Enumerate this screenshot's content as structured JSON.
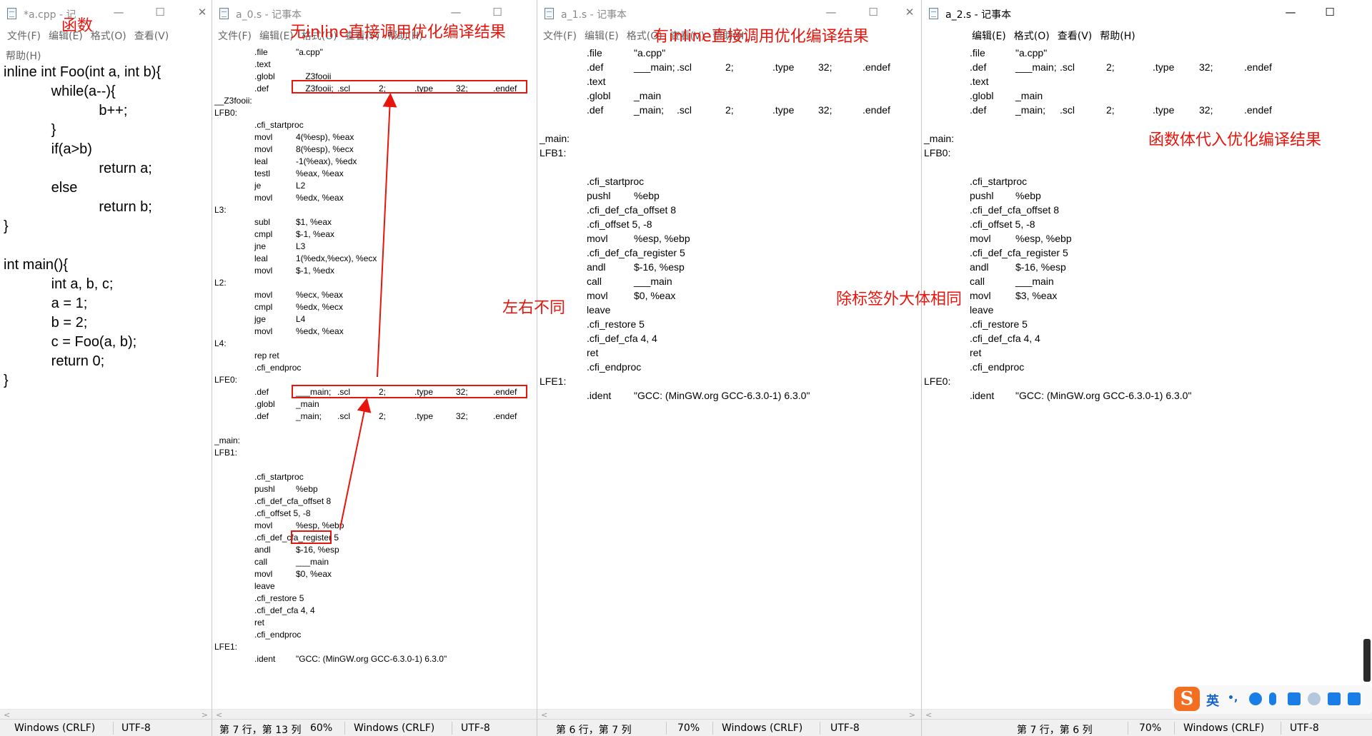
{
  "win_cpp": {
    "title": "*a.cpp - 记",
    "menu": [
      "文件(F)",
      "编辑(E)",
      "格式(O)",
      "查看(V)"
    ],
    "menu2": "帮助(H)",
    "code": [
      "inline int Foo(int a, int b){",
      "            while(a--){",
      "                        b++;",
      "            }",
      "            if(a>b)",
      "                        return a;",
      "            else",
      "                        return b;",
      "}",
      "",
      "int main(){",
      "            int a, b, c;",
      "            a = 1;",
      "            b = 2;",
      "            c = Foo(a, b);",
      "            return 0;",
      "}"
    ],
    "status": [
      "Windows (CRLF)",
      "UTF-8"
    ]
  },
  "win_a0": {
    "title": "a_0.s - 记事本",
    "menu": [
      "文件(F)",
      "编辑(E)",
      "格式(O)",
      "查看(V)",
      "帮助(H)"
    ],
    "lines": [
      [
        "",
        ".file",
        "\"a.cpp\"",
        "",
        "",
        "",
        "",
        ""
      ],
      [
        "",
        ".text",
        "",
        "",
        "",
        "",
        "",
        ""
      ],
      [
        "",
        ".globl",
        "__Z3fooii",
        "",
        "",
        "",
        "",
        ""
      ],
      [
        "",
        ".def",
        "__Z3fooii;",
        ".scl",
        "2;",
        ".type",
        "32;",
        ".endef"
      ],
      [
        "__Z3fooii:",
        "",
        "",
        "",
        "",
        "",
        "",
        ""
      ],
      [
        "LFB0:",
        "",
        "",
        "",
        "",
        "",
        "",
        ""
      ],
      [
        "",
        ".cfi_startproc",
        "",
        "",
        "",
        "",
        "",
        ""
      ],
      [
        "",
        "movl",
        "4(%esp), %eax",
        "",
        "",
        "",
        "",
        ""
      ],
      [
        "",
        "movl",
        "8(%esp), %ecx",
        "",
        "",
        "",
        "",
        ""
      ],
      [
        "",
        "leal",
        "-1(%eax), %edx",
        "",
        "",
        "",
        "",
        ""
      ],
      [
        "",
        "testl",
        "%eax, %eax",
        "",
        "",
        "",
        "",
        ""
      ],
      [
        "",
        "je",
        "L2",
        "",
        "",
        "",
        "",
        ""
      ],
      [
        "",
        "movl",
        "%edx, %eax",
        "",
        "",
        "",
        "",
        ""
      ],
      [
        "L3:",
        "",
        "",
        "",
        "",
        "",
        "",
        ""
      ],
      [
        "",
        "subl",
        "$1, %eax",
        "",
        "",
        "",
        "",
        ""
      ],
      [
        "",
        "cmpl",
        "$-1, %eax",
        "",
        "",
        "",
        "",
        ""
      ],
      [
        "",
        "jne",
        "L3",
        "",
        "",
        "",
        "",
        ""
      ],
      [
        "",
        "leal",
        "1(%edx,%ecx), %ecx",
        "",
        "",
        "",
        "",
        ""
      ],
      [
        "",
        "movl",
        "$-1, %edx",
        "",
        "",
        "",
        "",
        ""
      ],
      [
        "L2:",
        "",
        "",
        "",
        "",
        "",
        "",
        ""
      ],
      [
        "",
        "movl",
        "%ecx, %eax",
        "",
        "",
        "",
        "",
        ""
      ],
      [
        "",
        "cmpl",
        "%edx, %ecx",
        "",
        "",
        "",
        "",
        ""
      ],
      [
        "",
        "jge",
        "L4",
        "",
        "",
        "",
        "",
        ""
      ],
      [
        "",
        "movl",
        "%edx, %eax",
        "",
        "",
        "",
        "",
        ""
      ],
      [
        "L4:",
        "",
        "",
        "",
        "",
        "",
        "",
        ""
      ],
      [
        "",
        "rep ret",
        "",
        "",
        "",
        "",
        "",
        ""
      ],
      [
        "",
        ".cfi_endproc",
        "",
        "",
        "",
        "",
        "",
        ""
      ],
      [
        "LFE0:",
        "",
        "",
        "",
        "",
        "",
        "",
        ""
      ],
      [
        "",
        ".def",
        "___main;",
        ".scl",
        "2;",
        ".type",
        "32;",
        ".endef"
      ],
      [
        "",
        ".globl",
        "_main",
        "",
        "",
        "",
        "",
        ""
      ],
      [
        "",
        ".def",
        "_main;",
        ".scl",
        "2;",
        ".type",
        "32;",
        ".endef"
      ],
      [
        "",
        "",
        "",
        "",
        "",
        "",
        "",
        ""
      ],
      [
        "_main:",
        "",
        "",
        "",
        "",
        "",
        "",
        ""
      ],
      [
        "LFB1:",
        "",
        "",
        "",
        "",
        "",
        "",
        ""
      ],
      [
        "",
        "",
        "",
        "",
        "",
        "",
        "",
        ""
      ],
      [
        "",
        ".cfi_startproc",
        "",
        "",
        "",
        "",
        "",
        ""
      ],
      [
        "",
        "pushl",
        "%ebp",
        "",
        "",
        "",
        "",
        ""
      ],
      [
        "",
        ".cfi_def_cfa_offset 8",
        "",
        "",
        "",
        "",
        "",
        ""
      ],
      [
        "",
        ".cfi_offset 5, -8",
        "",
        "",
        "",
        "",
        "",
        ""
      ],
      [
        "",
        "movl",
        "%esp, %ebp",
        "",
        "",
        "",
        "",
        ""
      ],
      [
        "",
        ".cfi_def_cfa_register 5",
        "",
        "",
        "",
        "",
        "",
        ""
      ],
      [
        "",
        "andl",
        "$-16, %esp",
        "",
        "",
        "",
        "",
        ""
      ],
      [
        "",
        "call",
        "___main",
        "",
        "",
        "",
        "",
        ""
      ],
      [
        "",
        "movl",
        "$0, %eax",
        "",
        "",
        "",
        "",
        ""
      ],
      [
        "",
        "leave",
        "",
        "",
        "",
        "",
        "",
        ""
      ],
      [
        "",
        ".cfi_restore 5",
        "",
        "",
        "",
        "",
        "",
        ""
      ],
      [
        "",
        ".cfi_def_cfa 4, 4",
        "",
        "",
        "",
        "",
        "",
        ""
      ],
      [
        "",
        "ret",
        "",
        "",
        "",
        "",
        "",
        ""
      ],
      [
        "",
        ".cfi_endproc",
        "",
        "",
        "",
        "",
        "",
        ""
      ],
      [
        "LFE1:",
        "",
        "",
        "",
        "",
        "",
        "",
        ""
      ],
      [
        "",
        ".ident",
        "\"GCC: (MinGW.org GCC-6.3.0-1) 6.3.0\"",
        "",
        "",
        "",
        "",
        ""
      ]
    ],
    "status": [
      "第 7 行，第 13 列",
      "60%",
      "Windows (CRLF)",
      "UTF-8"
    ]
  },
  "win_a1": {
    "title": "a_1.s - 记事本",
    "menu": [
      "文件(F)",
      "编辑(E)",
      "格式(O)",
      "查看(V)",
      "帮助(H)"
    ],
    "lines": [
      [
        "",
        ".file",
        "\"a.cpp\"",
        "",
        "",
        "",
        "",
        ""
      ],
      [
        "",
        ".def",
        "___main;",
        ".scl",
        "2;",
        ".type",
        "32;",
        ".endef"
      ],
      [
        "",
        ".text",
        "",
        "",
        "",
        "",
        "",
        ""
      ],
      [
        "",
        ".globl",
        "_main",
        "",
        "",
        "",
        "",
        ""
      ],
      [
        "",
        ".def",
        "_main;",
        ".scl",
        "2;",
        ".type",
        "32;",
        ".endef"
      ],
      [
        "",
        "",
        "",
        "",
        "",
        "",
        "",
        ""
      ],
      [
        "_main:",
        "",
        "",
        "",
        "",
        "",
        "",
        ""
      ],
      [
        "LFB1:",
        "",
        "",
        "",
        "",
        "",
        "",
        ""
      ],
      [
        "",
        "",
        "",
        "",
        "",
        "",
        "",
        ""
      ],
      [
        "",
        ".cfi_startproc",
        "",
        "",
        "",
        "",
        "",
        ""
      ],
      [
        "",
        "pushl",
        "%ebp",
        "",
        "",
        "",
        "",
        ""
      ],
      [
        "",
        ".cfi_def_cfa_offset 8",
        "",
        "",
        "",
        "",
        "",
        ""
      ],
      [
        "",
        ".cfi_offset 5, -8",
        "",
        "",
        "",
        "",
        "",
        ""
      ],
      [
        "",
        "movl",
        "%esp, %ebp",
        "",
        "",
        "",
        "",
        ""
      ],
      [
        "",
        ".cfi_def_cfa_register 5",
        "",
        "",
        "",
        "",
        "",
        ""
      ],
      [
        "",
        "andl",
        "$-16, %esp",
        "",
        "",
        "",
        "",
        ""
      ],
      [
        "",
        "call",
        "___main",
        "",
        "",
        "",
        "",
        ""
      ],
      [
        "",
        "movl",
        "$0, %eax",
        "",
        "",
        "",
        "",
        ""
      ],
      [
        "",
        "leave",
        "",
        "",
        "",
        "",
        "",
        ""
      ],
      [
        "",
        ".cfi_restore 5",
        "",
        "",
        "",
        "",
        "",
        ""
      ],
      [
        "",
        ".cfi_def_cfa 4, 4",
        "",
        "",
        "",
        "",
        "",
        ""
      ],
      [
        "",
        "ret",
        "",
        "",
        "",
        "",
        "",
        ""
      ],
      [
        "",
        ".cfi_endproc",
        "",
        "",
        "",
        "",
        "",
        ""
      ],
      [
        "LFE1:",
        "",
        "",
        "",
        "",
        "",
        "",
        ""
      ],
      [
        "",
        ".ident",
        "\"GCC: (MinGW.org GCC-6.3.0-1) 6.3.0\"",
        "",
        "",
        "",
        "",
        ""
      ]
    ],
    "status": [
      "第 6 行，第 7 列",
      "70%",
      "Windows (CRLF)",
      "UTF-8"
    ]
  },
  "win_a2": {
    "title": "a_2.s - 记事本",
    "menu": [
      "编辑(E)",
      "格式(O)",
      "查看(V)",
      "帮助(H)"
    ],
    "lines": [
      [
        "",
        ".file",
        "\"a.cpp\"",
        "",
        "",
        "",
        "",
        ""
      ],
      [
        "",
        ".def",
        "___main;",
        ".scl",
        "2;",
        ".type",
        "32;",
        ".endef"
      ],
      [
        "",
        ".text",
        "",
        "",
        "",
        "",
        "",
        ""
      ],
      [
        "",
        ".globl",
        "_main",
        "",
        "",
        "",
        "",
        ""
      ],
      [
        "",
        ".def",
        "_main;",
        ".scl",
        "2;",
        ".type",
        "32;",
        ".endef"
      ],
      [
        "",
        "",
        "",
        "",
        "",
        "",
        "",
        ""
      ],
      [
        "_main:",
        "",
        "",
        "",
        "",
        "",
        "",
        ""
      ],
      [
        "LFB0:",
        "",
        "",
        "",
        "",
        "",
        "",
        ""
      ],
      [
        "",
        "",
        "",
        "",
        "",
        "",
        "",
        ""
      ],
      [
        "",
        ".cfi_startproc",
        "",
        "",
        "",
        "",
        "",
        ""
      ],
      [
        "",
        "pushl",
        "%ebp",
        "",
        "",
        "",
        "",
        ""
      ],
      [
        "",
        ".cfi_def_cfa_offset 8",
        "",
        "",
        "",
        "",
        "",
        ""
      ],
      [
        "",
        ".cfi_offset 5, -8",
        "",
        "",
        "",
        "",
        "",
        ""
      ],
      [
        "",
        "movl",
        "%esp, %ebp",
        "",
        "",
        "",
        "",
        ""
      ],
      [
        "",
        ".cfi_def_cfa_register 5",
        "",
        "",
        "",
        "",
        "",
        ""
      ],
      [
        "",
        "andl",
        "$-16, %esp",
        "",
        "",
        "",
        "",
        ""
      ],
      [
        "",
        "call",
        "___main",
        "",
        "",
        "",
        "",
        ""
      ],
      [
        "",
        "movl",
        "$3, %eax",
        "",
        "",
        "",
        "",
        ""
      ],
      [
        "",
        "leave",
        "",
        "",
        "",
        "",
        "",
        ""
      ],
      [
        "",
        ".cfi_restore 5",
        "",
        "",
        "",
        "",
        "",
        ""
      ],
      [
        "",
        ".cfi_def_cfa 4, 4",
        "",
        "",
        "",
        "",
        "",
        ""
      ],
      [
        "",
        "ret",
        "",
        "",
        "",
        "",
        "",
        ""
      ],
      [
        "",
        ".cfi_endproc",
        "",
        "",
        "",
        "",
        "",
        ""
      ],
      [
        "LFE0:",
        "",
        "",
        "",
        "",
        "",
        "",
        ""
      ],
      [
        "",
        ".ident",
        "\"GCC: (MinGW.org GCC-6.3.0-1) 6.3.0\"",
        "",
        "",
        "",
        "",
        ""
      ]
    ],
    "status": [
      "第 7 行，第 6 列",
      "70%",
      "Windows (CRLF)",
      "UTF-8"
    ]
  },
  "annotations": {
    "func": "函数",
    "no_inline": "无inline直接调用优化编译结果",
    "with_inline": "有inline直接调用优化编译结果",
    "body_subst": "函数体代入优化编译结果",
    "diff": "左右不同",
    "same": "除标签外大体相同"
  },
  "window_controls": {
    "minimize": "—",
    "maximize": "☐",
    "close": "✕"
  },
  "ime": {
    "label": "英",
    "punct": "•,",
    "logo": "S"
  },
  "colors": {
    "annotation_red": "#e8150c",
    "statusbar": "#f0f0f0",
    "ime_logo": "#f36e21",
    "ime_icon": "#1b7ee6"
  }
}
